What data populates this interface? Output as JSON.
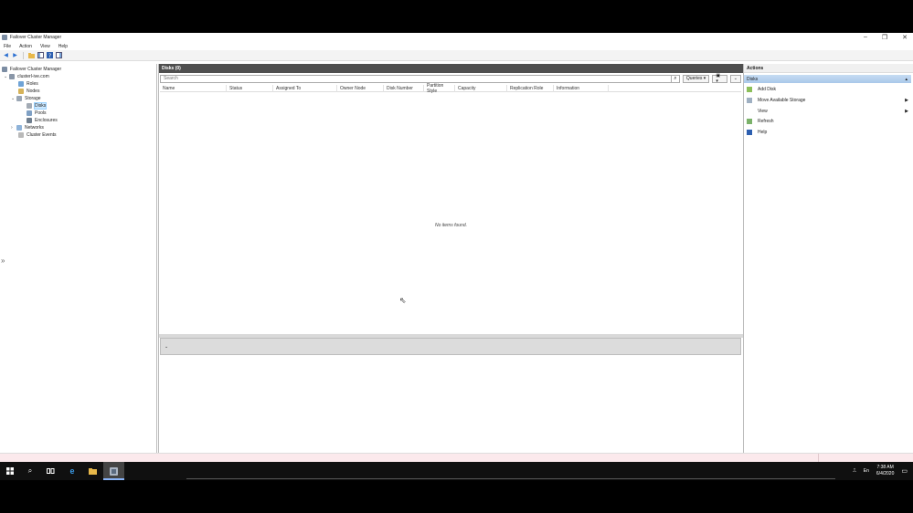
{
  "window": {
    "title": "Failover Cluster Manager",
    "controls": {
      "minimize": "–",
      "restore": "❐",
      "close": "✕"
    }
  },
  "menu": [
    "File",
    "Action",
    "View",
    "Help"
  ],
  "nav": {
    "items": [
      {
        "label": "Failover Cluster Manager",
        "icon": "cluster-manager-icon"
      },
      {
        "label": "clusterl-ive.com",
        "icon": "cluster-icon"
      },
      {
        "label": "Roles",
        "icon": "roles-icon"
      },
      {
        "label": "Nodes",
        "icon": "nodes-icon"
      },
      {
        "label": "Storage",
        "icon": "storage-icon"
      },
      {
        "label": "Disks",
        "icon": "disks-icon"
      },
      {
        "label": "Pools",
        "icon": "pools-icon"
      },
      {
        "label": "Enclosures",
        "icon": "enclosures-icon"
      },
      {
        "label": "Networks",
        "icon": "networks-icon"
      },
      {
        "label": "Cluster Events",
        "icon": "cluster-events-icon"
      }
    ]
  },
  "center": {
    "header": "Disks (0)",
    "search_placeholder": "Search",
    "queries_label": "Queries",
    "columns": [
      "Name",
      "Status",
      "Assigned To",
      "Owner Node",
      "Disk Number",
      "Partition Style",
      "Capacity",
      "Replication Role",
      "Information"
    ],
    "empty_message": "No items found."
  },
  "actions": {
    "header": "Actions",
    "group": "Disks",
    "items": [
      {
        "label": "Add Disk",
        "icon": "add-disk-icon",
        "submenu": false
      },
      {
        "label": "Move Available Storage",
        "icon": "move-storage-icon",
        "submenu": true
      },
      {
        "label": "View",
        "icon": "",
        "submenu": true
      },
      {
        "label": "Refresh",
        "icon": "refresh-icon",
        "submenu": false
      },
      {
        "label": "Help",
        "icon": "help-icon",
        "submenu": false
      }
    ]
  },
  "taskbar": {
    "time": "7:38 AM",
    "date": "6/4/2020",
    "tray_lang": "En"
  },
  "colors": {
    "header_bg": "#4f4f4f",
    "selection": "#cce8ff",
    "actions_group": "#b7d2ee",
    "statusbar": "#fbe9ec"
  }
}
